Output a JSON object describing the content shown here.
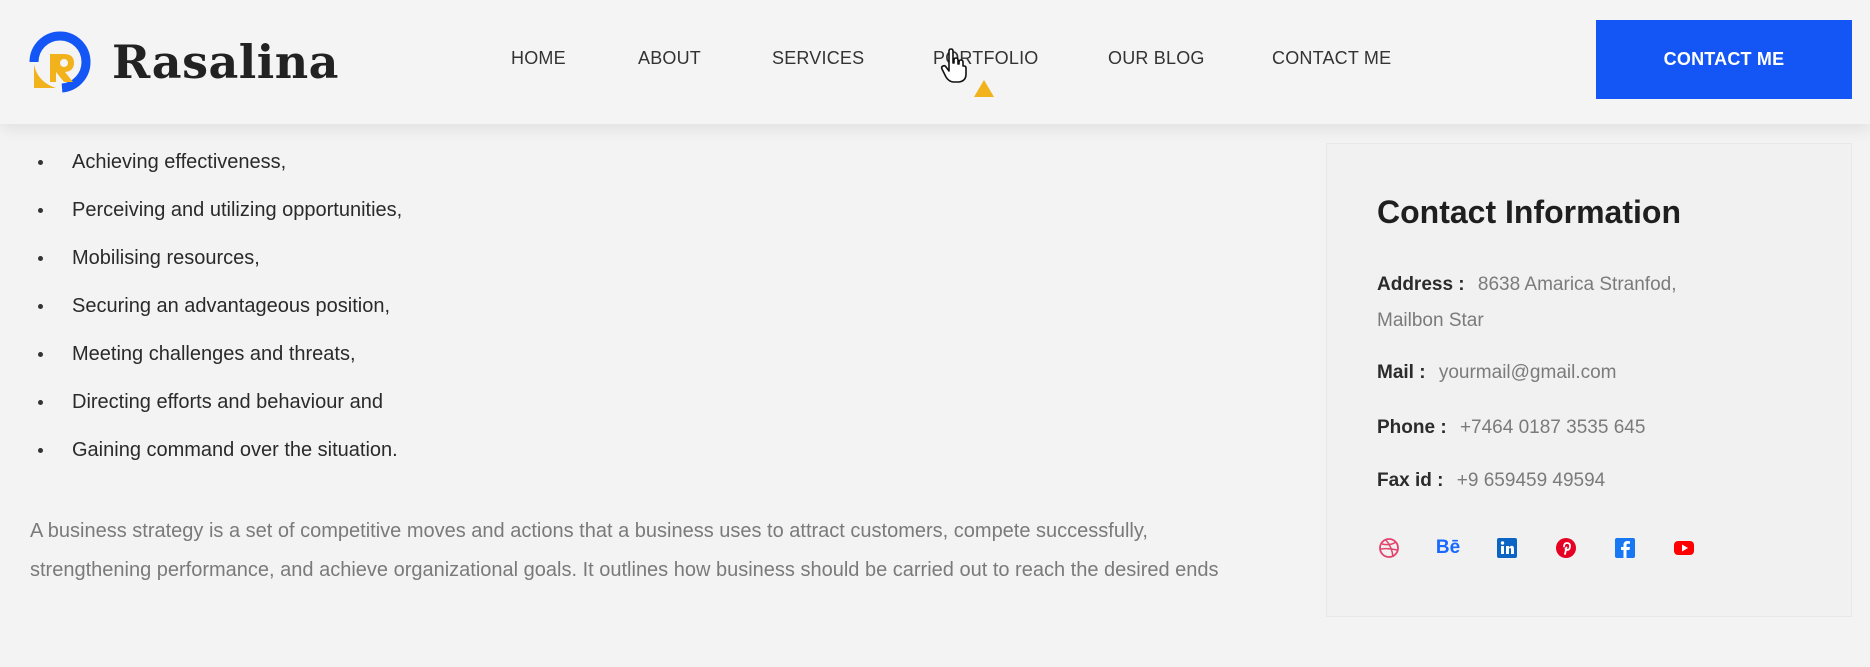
{
  "brand": {
    "name": "Rasalina",
    "accent_blue": "#1356f5",
    "accent_yellow": "#f2b21b"
  },
  "nav": {
    "items": [
      {
        "label": "HOME"
      },
      {
        "label": "ABOUT"
      },
      {
        "label": "SERVICES"
      },
      {
        "label": "PORTFOLIO"
      },
      {
        "label": "OUR BLOG"
      },
      {
        "label": "CONTACT ME"
      }
    ],
    "hovered": "PORTFOLIO",
    "cta_label": "CONTACT ME"
  },
  "content": {
    "bullets": [
      "Achieving effectiveness,",
      "Perceiving and utilizing opportunities,",
      "Mobilising resources,",
      "Securing an advantageous position,",
      "Meeting challenges and threats,",
      "Directing efforts and behaviour and",
      "Gaining command over the situation."
    ],
    "paragraph": "A business strategy is a set of competitive moves and actions that a business uses to attract customers, compete successfully, strengthening performance, and achieve organizational goals. It outlines how business should be carried out to reach the desired ends"
  },
  "contact": {
    "title": "Contact Information",
    "address_label": "Address :",
    "address_line1": "8638 Amarica Stranfod,",
    "address_line2": "Mailbon Star",
    "mail_label": "Mail :",
    "mail_value": "yourmail@gmail.com",
    "phone_label": "Phone :",
    "phone_value": "+7464 0187 3535 645",
    "fax_label": "Fax id :",
    "fax_value": "+9 659459 49594",
    "socials": [
      "dribbble-icon",
      "behance-icon",
      "linkedin-icon",
      "pinterest-icon",
      "facebook-icon",
      "youtube-icon"
    ],
    "behance_text": "Bē"
  }
}
